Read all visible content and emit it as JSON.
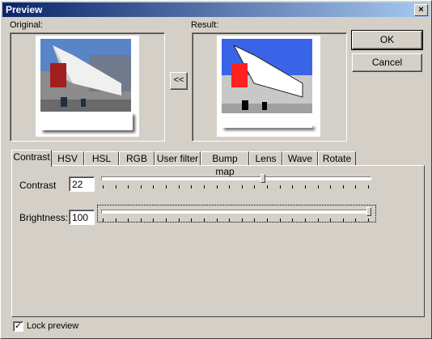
{
  "window": {
    "title": "Preview",
    "close_glyph": "×"
  },
  "original": {
    "label": "Original:"
  },
  "result": {
    "label": "Result:"
  },
  "copy_button": {
    "label": "<<"
  },
  "buttons": {
    "ok": "OK",
    "cancel": "Cancel"
  },
  "tabs": [
    "Contrast",
    "HSV",
    "HSL",
    "RGB",
    "User filter",
    "Bump map",
    "Lens",
    "Wave",
    "Rotate"
  ],
  "active_tab": "Contrast",
  "contrast": {
    "contrast_label": "Contrast",
    "contrast_value": "22",
    "contrast_level": 0.6,
    "brightness_label": "Brightness:",
    "brightness_value": "100",
    "brightness_level": 1.0
  },
  "lock_preview": {
    "label": "Lock preview",
    "checked": true,
    "check_glyph": "✓"
  },
  "icons": {
    "original_image": "space-shuttle-photo",
    "result_image": "space-shuttle-photo-brightened"
  }
}
